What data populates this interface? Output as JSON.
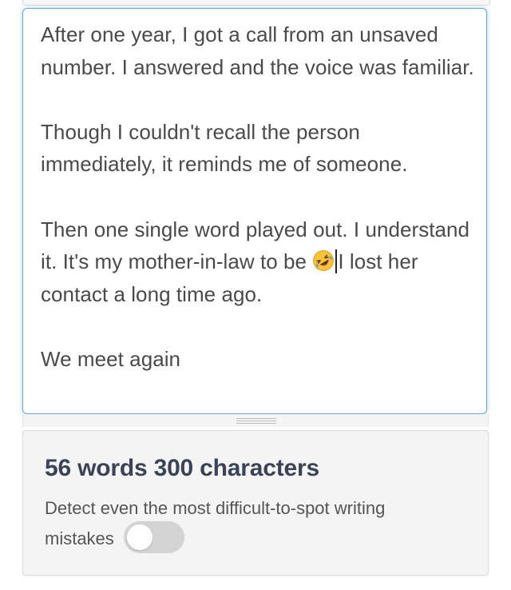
{
  "editor": {
    "paragraph_1": "After one year, I got a call from an unsaved number.  I answered and the voice was familiar.",
    "paragraph_2": "Though I couldn't recall the person immediately, it reminds me of someone.",
    "paragraph_3_before_emoji": "Then one single word played out. I understand it. It's my mother-in-law to be ",
    "paragraph_3_after_caret": "I lost her contact a long time ago.",
    "paragraph_4": "We meet again",
    "emoji_icon": "rolling-on-floor-laughing-emoji"
  },
  "stats": {
    "title": "56 words 300 characters",
    "word_count": 56,
    "character_count": 300,
    "description": "Detect even the most difficult-to-spot writing mistakes",
    "toggle_on": false
  },
  "colors": {
    "editor_border": "#6aa7dc",
    "text": "#4a4a4a",
    "title": "#3b4356",
    "panel_bg": "#f4f4f4",
    "toggle_off": "#d4d4d4",
    "emoji_yellow": "#f7c33b",
    "emoji_tear": "#4a9ee8"
  }
}
